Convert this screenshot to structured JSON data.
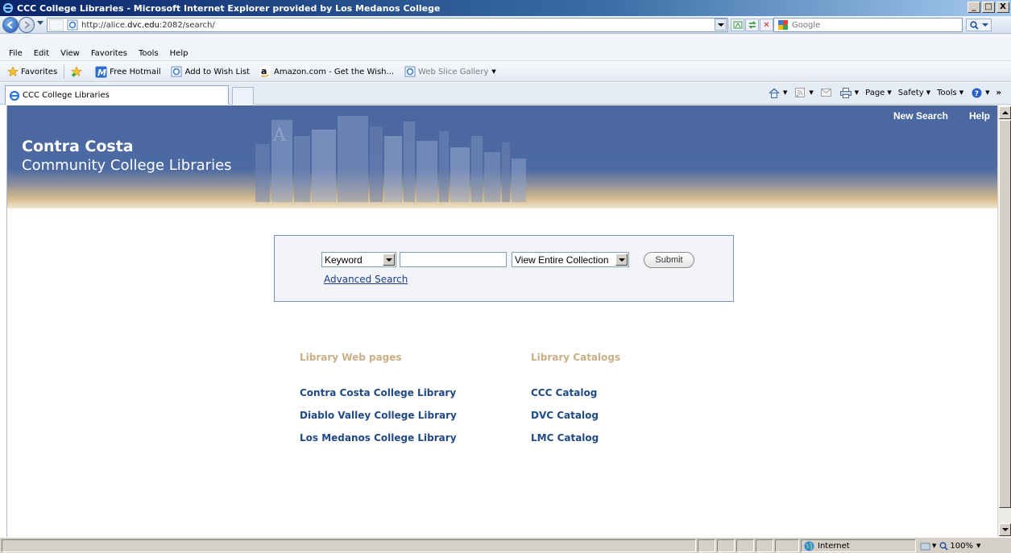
{
  "window": {
    "title": "CCC College Libraries - Microsoft Internet Explorer provided by Los Medanos College",
    "min_label": "_",
    "max_label": "□",
    "close_label": "X"
  },
  "address": {
    "url_prefix": "http://alice.",
    "url_domain": "dvc.edu",
    "url_suffix": ":2082/search/",
    "search_placeholder": "Google"
  },
  "menu": {
    "items": [
      "File",
      "Edit",
      "View",
      "Favorites",
      "Tools",
      "Help"
    ]
  },
  "favorites": {
    "label": "Favorites",
    "items": [
      {
        "label": "Free Hotmail",
        "icon": "hotmail-icon"
      },
      {
        "label": "Add to Wish List",
        "icon": "ie-page-icon"
      },
      {
        "label": "Amazon.com - Get the Wish...",
        "icon": "amazon-icon"
      },
      {
        "label": "Web Slice Gallery",
        "icon": "ie-page-icon"
      }
    ]
  },
  "tab": {
    "label": "CCC College Libraries"
  },
  "commandbar": {
    "page": "Page",
    "safety": "Safety",
    "tools": "Tools"
  },
  "banner": {
    "brand_line1": "Contra Costa",
    "brand_line2": "Community College Libraries",
    "new_search": "New Search",
    "help": "Help"
  },
  "search": {
    "field_selected": "Keyword",
    "query_value": "",
    "collection_selected": "View Entire Collection",
    "submit_label": "Submit",
    "advanced_label": "Advanced Search"
  },
  "links": {
    "web_pages_heading": "Library Web pages",
    "catalogs_heading": "Library Catalogs",
    "web_pages": [
      "Contra Costa College Library",
      "Diablo Valley College Library",
      "Los Medanos College Library"
    ],
    "catalogs": [
      "CCC Catalog",
      "DVC Catalog",
      "LMC Catalog"
    ]
  },
  "status": {
    "zone": "Internet",
    "zoom": "100%"
  },
  "colors": {
    "banner_blue": "#4d6aa2",
    "heading_tan": "#c9ae86",
    "link_blue": "#1f4a86"
  }
}
